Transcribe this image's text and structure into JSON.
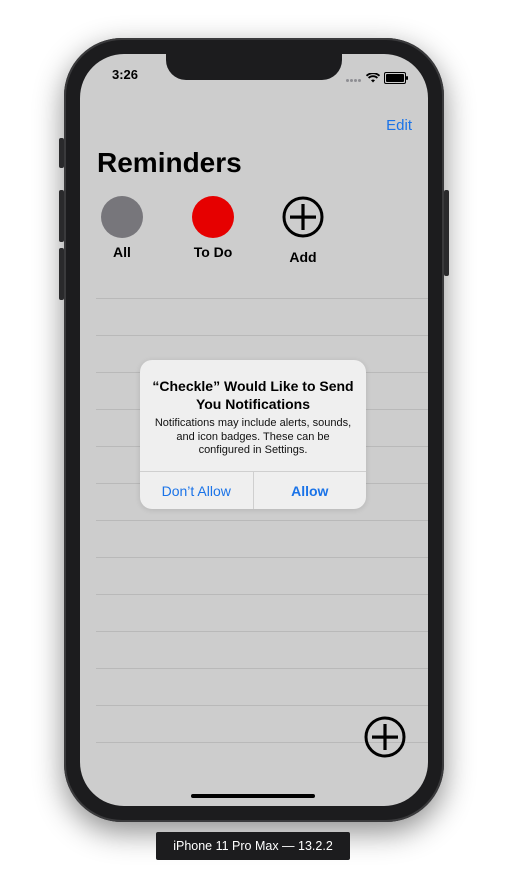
{
  "status": {
    "time": "3:26"
  },
  "nav": {
    "edit_label": "Edit"
  },
  "page": {
    "title": "Reminders"
  },
  "categories": [
    {
      "label": "All",
      "color": "#77767b"
    },
    {
      "label": "To Do",
      "color": "#e60000"
    },
    {
      "label": "Add",
      "icon": "plus-circle-icon"
    }
  ],
  "fab": {
    "icon": "plus-circle-icon"
  },
  "alert": {
    "title": "“Checkle” Would Like to Send You Notifications",
    "message": "Notifications may include alerts, sounds, and icon badges. These can be configured in Settings.",
    "deny_label": "Don’t Allow",
    "allow_label": "Allow"
  },
  "device": {
    "label": "iPhone 11 Pro Max — 13.2.2"
  },
  "colors": {
    "accent": "#1a73e8",
    "screen_bg": "#cdcdcd"
  }
}
